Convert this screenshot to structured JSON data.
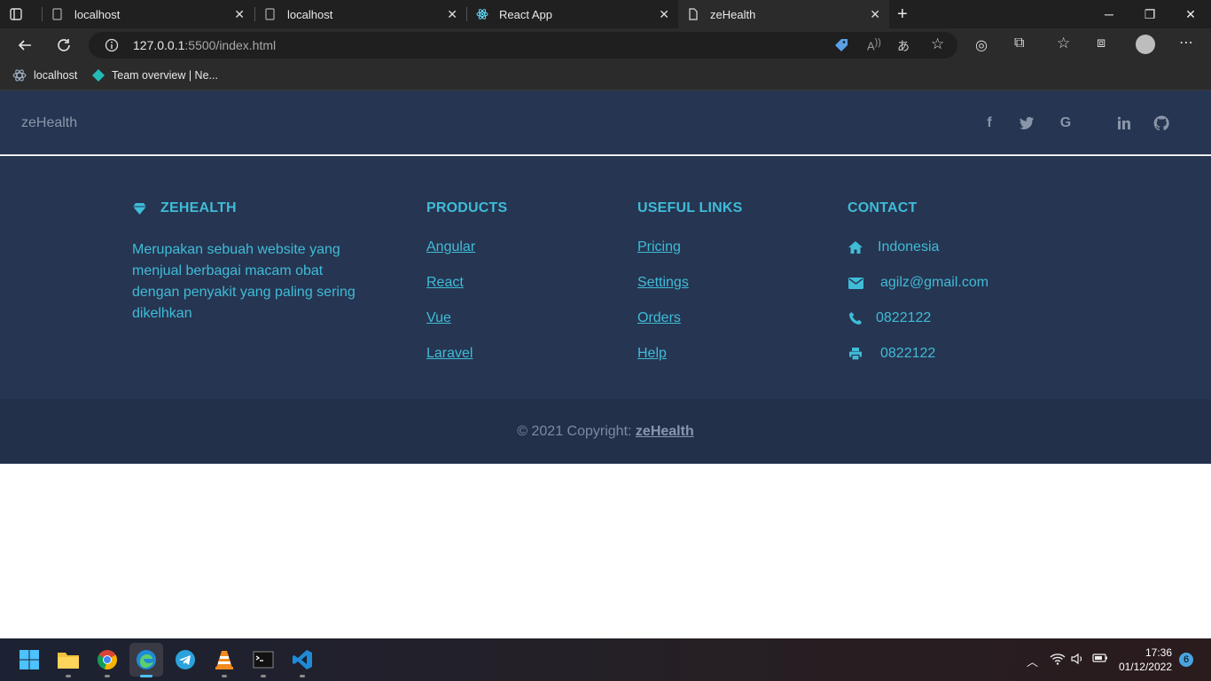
{
  "browser": {
    "tabs": [
      {
        "title": "localhost",
        "icon": "page-icon"
      },
      {
        "title": "localhost",
        "icon": "page-icon"
      },
      {
        "title": "React App",
        "icon": "react-icon"
      },
      {
        "title": "zeHealth",
        "icon": "document-icon",
        "active": true
      }
    ],
    "new_tab": "+",
    "url_host": "127.0.0.1",
    "url_path": ":5500/index.html",
    "bookmarks": [
      {
        "label": "localhost",
        "icon": "react-icon"
      },
      {
        "label": "Team overview | Ne...",
        "icon": "netlify-icon"
      }
    ]
  },
  "site": {
    "brand": "zeHealth",
    "social_icons": [
      "facebook-icon",
      "twitter-icon",
      "google-icon",
      "linkedin-icon",
      "github-icon"
    ],
    "about": {
      "title": "ZEHEALTH",
      "text": "Merupakan sebuah website yang menjual berbagai macam obat dengan penyakit yang paling sering dikelhkan"
    },
    "products": {
      "title": "PRODUCTS",
      "links": [
        "Angular",
        "React",
        "Vue",
        "Laravel"
      ]
    },
    "useful_links": {
      "title": "USEFUL LINKS",
      "links": [
        "Pricing",
        "Settings",
        "Orders",
        "Help"
      ]
    },
    "contact": {
      "title": "CONTACT",
      "items": [
        {
          "icon": "home-icon",
          "text": "Indonesia"
        },
        {
          "icon": "envelope-icon",
          "text": "agilz@gmail.com"
        },
        {
          "icon": "phone-icon",
          "text": "0822122"
        },
        {
          "icon": "print-icon",
          "text": "0822122"
        }
      ]
    },
    "copyright_prefix": "© 2021 Copyright:",
    "copyright_brand": "zeHealth"
  },
  "taskbar": {
    "time": "17:36",
    "date": "01/12/2022",
    "notifications": "6"
  },
  "colors": {
    "footer_bg": "#263551",
    "accent": "#3fbcd8",
    "copyright_bg": "#22304a"
  }
}
